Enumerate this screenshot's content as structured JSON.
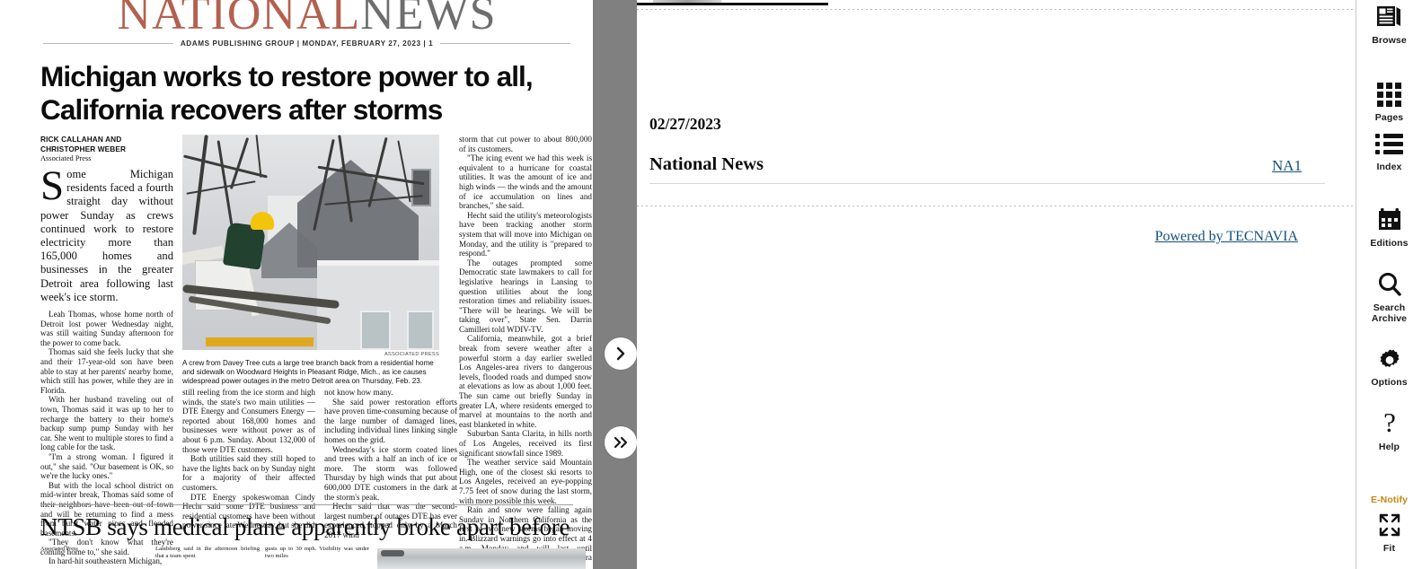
{
  "newspaper": {
    "masthead": {
      "part1": "NATIONAL",
      "part2": "NEWS"
    },
    "publisher_line": "ADAMS PUBLISHING GROUP  |  MONDAY, FEBRUARY 27, 2023  |  1",
    "headline": "Michigan works to restore power to all, California recovers after storms",
    "byline": "RICK CALLAHAN AND CHRISTOPHER WEBER",
    "byline_org": "Associated Press",
    "lede": "Some Michigan residents faced a fourth straight day without power Sunday as crews continued work to restore electricity more than 165,000 homes and businesses in the greater Detroit area following last week's ice storm.",
    "col1_paragraphs": [
      "Leah Thomas, whose home north of Detroit lost power Wednesday night, was still waiting Sunday afternoon for the power to come back.",
      "Thomas said she feels lucky that she and their 17-year-old son have been able to stay at her parents' nearby home, which still has power, while they are in Florida.",
      "With her husband traveling out of town, Thomas said it was up to her to recharge the battery to their home's backup sump pump Sunday with her car. She went to multiple stores to find a long cable for the task.",
      "\"I'm a strong woman. I figured it out,\" she said. \"Our basement is OK, so we're the lucky ones.\"",
      "But with the local school district on mid-winter break, Thomas said some of their neighbors have been out of town and will be returning to find a mess from burst water pipes and flooded basements.",
      "\"They don't know what they're coming home to,\" she said.",
      "In hard-hit southeastern Michigan,"
    ],
    "photo_credit": "ASSOCIATED PRESS",
    "photo_caption": "A crew from Davey Tree cuts a large tree branch back from a residential home and sidewalk on Woodward Heights in Pleasant Ridge, Mich., as ice causes widespread power outages in the metro Detroit area on Thursday, Feb. 23.",
    "col2_paragraphs": [
      "still reeling from the ice storm and high winds, the state's two main utilities — DTE Energy and Consumers Energy — reported about 168,000 homes and businesses were without power as of about 6 p.m. Sunday. About 132,000 of those were DTE customers.",
      "Both utilities said they still hoped to have the lights back on by Sunday night for a majority of their affected customers.",
      "DTE Energy spokeswoman Cindy Hecht said some DTE business and residential customers have been without power since late Wednesday, but she did"
    ],
    "col3_paragraphs": [
      "not know how many.",
      "She said power restoration efforts have proven time-consuming because of the large number of damaged lines, including individual lines linking single homes on the grid.",
      "Wednesday's ice storm coated lines and trees with a half an inch of ice or more. The storm was followed Thursday by high winds that put about 600,000 DTE customers in the dark at the storm's peak.",
      "Hecht said that was the second-largest number of outages DTE has ever experienced, topped only by a March 2017 wind"
    ],
    "col4_paragraphs": [
      "storm that cut power to about 800,000 of its customers.",
      "\"The icing event we had this week is equivalent to a hurricane for coastal utilities. It was the amount of ice and high winds — the winds and the amount of ice accumulation on lines and branches,\" she said.",
      "Hecht said the utility's meteorologists have been tracking another storm system that will move into Michigan on Monday, and the utility is \"prepared to respond.\"",
      "The outages prompted some Democratic state lawmakers to call for legislative hearings in Lansing to question utilities about the long restoration times and reliability issues. \"There will be hearings. We will be taking over\", State Sen. Darrin Camilleri told WDIV-TV.",
      "California, meanwhile, got a brief break from severe weather after a powerful storm a day earlier swelled Los Angeles-area rivers to dangerous levels, flooded roads and dumped snow at elevations as low as about 1,000 feet. The sun came out briefly Sunday in greater LA, where residents emerged to marvel at mountains to the north and east blanketed in white.",
      "Suburban Santa Clarita, in hills north of Los Angeles, received its first significant snowfall since 1989.",
      "The weather service said Mountain High, one of the closest ski resorts to Los Angeles, received an eye-popping 7.75 feet of snow during the last storm, with more possible this week.",
      "Rain and snow were falling again Sunday in Northern California as the first of two new storms began moving in. Blizzard warnings go into effect at 4 a.m. Monday and will last until Wednesday for much of the Sierra Nevada."
    ],
    "headline2": "NTSB says medical plane apparently broke apart before",
    "foot_org": "Associated Press",
    "foot_col2": "Landsberg said in the afternoon briefing that a team spent",
    "foot_col3": "gusts up to 30 mph. Visibility was under two miles"
  },
  "navigation": {
    "next_label": "next-page",
    "skip_label": "skip-forward"
  },
  "index_panel": {
    "date": "02/27/2023",
    "section_title": "National News",
    "page_ref": "NA1",
    "powered_by": "Powered by TECNAVIA"
  },
  "toolbar": {
    "items": [
      {
        "label": "Browse",
        "icon": "browse-icon"
      },
      {
        "label": "Pages",
        "icon": "pages-grid-icon"
      },
      {
        "label": "Index",
        "icon": "index-list-icon"
      },
      {
        "label": "Editions",
        "icon": "calendar-icon"
      },
      {
        "label": "Search\nArchive",
        "icon": "search-icon"
      },
      {
        "label": "Options",
        "icon": "gear-icon"
      },
      {
        "label": "Help",
        "icon": "question-mark-icon"
      },
      {
        "label": "E-Notify",
        "icon": "enotify-icon"
      },
      {
        "label": "Fit",
        "icon": "fit-expand-icon"
      }
    ],
    "search_line1": "Search",
    "search_line2": "Archive",
    "browse": "Browse",
    "pages": "Pages",
    "index": "Index",
    "editions": "Editions",
    "options": "Options",
    "help": "Help",
    "enotify": "E-Notify",
    "fit": "Fit"
  },
  "colors": {
    "masthead_accent": "#b3614f",
    "masthead_grey": "#6e6e6e",
    "link": "#12507a",
    "gray_strip": "#808080",
    "amber": "#c8860d"
  }
}
